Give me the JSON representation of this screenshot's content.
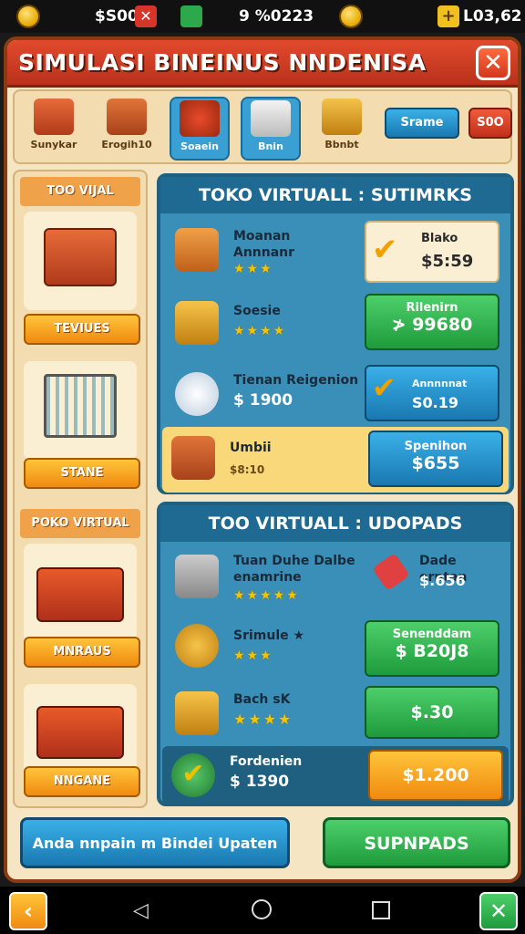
{
  "status": {
    "left_value": "$S00",
    "center_value": "9 %0223",
    "right_value": "L03,62"
  },
  "title": "SIMULASI BINEINUS NNDENISA",
  "categories": [
    {
      "label": "Sunykar"
    },
    {
      "label": "Erogih10"
    },
    {
      "label": "Soaein"
    },
    {
      "label": "Bnin"
    },
    {
      "label": "Bbnbt"
    }
  ],
  "top_buttons": {
    "blue": "Srame",
    "red": "S0O"
  },
  "left": {
    "head1": "TOO VIJAL",
    "btn1": "TEVIUES",
    "btn2": "STANE",
    "head2": "POKO VIRTUAL",
    "btn3": "MNRAUS",
    "btn4": "NNGANE"
  },
  "panel1": {
    "title": "TOKO VIRTUALL  :  SUTIMRKS",
    "rows": [
      {
        "name": "Moanan\nAnnnanr",
        "stars": "★★★",
        "price_label": "Blako",
        "price": "$5:59"
      },
      {
        "name": "Soesie",
        "stars": "★★★★",
        "price_label": "Rilenirn",
        "price": "≯ 99680"
      },
      {
        "name": "Tienan Reigenion",
        "price_sub": "$ 1900",
        "price_label": "Annnnnat",
        "price": "S0.19"
      },
      {
        "name": "Umbii",
        "price_sub": "$8:10",
        "price_label": "Spenihon",
        "price": "$655"
      }
    ]
  },
  "panel2": {
    "title": "TOO VIRTUALL  :  UDOPADS",
    "rows": [
      {
        "name": "Tuan Duhe Dalbe\nenamrine",
        "stars": "★★★★★",
        "right_name": "Dade erntan",
        "right_price": "$.656"
      },
      {
        "name": "Srimule ★",
        "stars": "★★★",
        "price_label": "Senenddam",
        "price": "$ B20J8"
      },
      {
        "name": "Bach sK",
        "stars": "★★★★",
        "price": "$.30"
      },
      {
        "name": "Fordenien",
        "price_sub": "$ 1390",
        "price": "$1.200"
      }
    ]
  },
  "bottom": {
    "blue_label": "Anda nnpain m Bindei Upaten",
    "green_label": "SUPNPADS"
  }
}
